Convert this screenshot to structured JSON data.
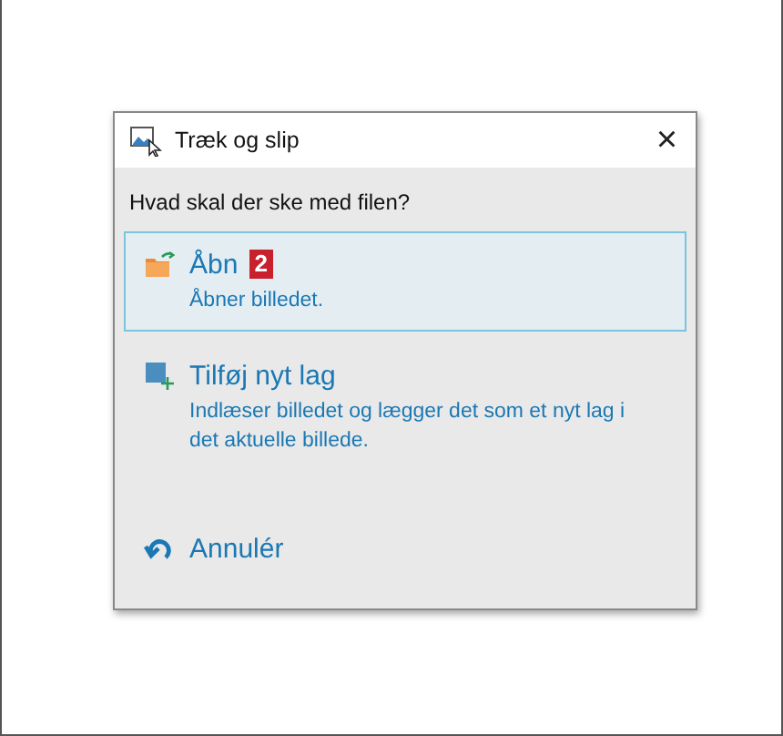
{
  "window": {
    "title": "Træk og slip",
    "close": "×"
  },
  "prompt": "Hvad skal der ske med filen?",
  "options": [
    {
      "kind": "open",
      "label": "Åbn",
      "badge": "2",
      "description": "Åbner billedet.",
      "selected": true
    },
    {
      "kind": "layer",
      "label": "Tilføj nyt lag",
      "description": "Indlæser billedet og lægger det som et nyt lag i det aktuelle billede.",
      "selected": false
    },
    {
      "kind": "cancel",
      "label": "Annulér",
      "selected": false
    }
  ]
}
